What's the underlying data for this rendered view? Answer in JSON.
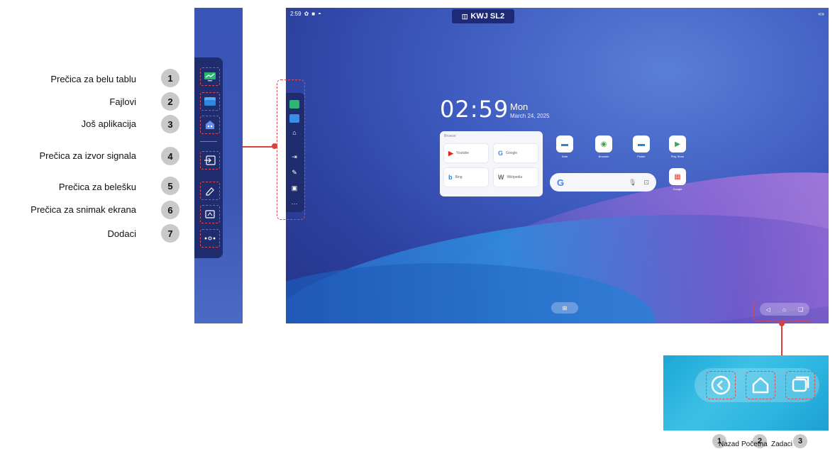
{
  "annotations": [
    {
      "num": "1",
      "label": "Prečica za belu tablu"
    },
    {
      "num": "2",
      "label": "Fajlovi"
    },
    {
      "num": "3",
      "label": "Još aplikacija"
    },
    {
      "num": "4",
      "label": "Prečica za izvor signala"
    },
    {
      "num": "5",
      "label": "Prečica za belešku"
    },
    {
      "num": "6",
      "label": "Prečica za snimak ekrana"
    },
    {
      "num": "7",
      "label": "Dodaci"
    }
  ],
  "screen": {
    "status_time": "2:59",
    "title": "KWJ SL2",
    "clock": "02:59",
    "day": "Mon",
    "date": "March 24, 2025",
    "widget": {
      "title": "Browse",
      "buttons": [
        {
          "label": "Youtube",
          "glyph": "▶",
          "color": "#e62117"
        },
        {
          "label": "Google",
          "glyph": "G",
          "color": "#4285f4"
        },
        {
          "label": "Bing",
          "glyph": "b",
          "color": "#1e88e5"
        },
        {
          "label": "Wikipedia",
          "glyph": "W",
          "color": "#666666"
        }
      ]
    },
    "apps": [
      {
        "label": "Note",
        "color": "#1e88e5",
        "glyph": "▬"
      },
      {
        "label": "Browser",
        "color": "#43a047",
        "glyph": "◉"
      },
      {
        "label": "Finder",
        "color": "#1e88e5",
        "glyph": "▬"
      },
      {
        "label": "Play Store",
        "color": "#ffffff",
        "glyph": "▶"
      },
      {
        "label": "Google",
        "color": "#ffffff",
        "glyph": "▦"
      }
    ],
    "search_glyph": "G"
  },
  "nav_bar": {
    "buttons": [
      {
        "num": "1",
        "label": "Nazad"
      },
      {
        "num": "2",
        "label": "Početna"
      },
      {
        "num": "3",
        "label": "Zadaci"
      }
    ]
  },
  "colors": {
    "sidebar": "#1f2c6e",
    "highlight": "#e24a4a",
    "badge": "#c9c9c9"
  }
}
